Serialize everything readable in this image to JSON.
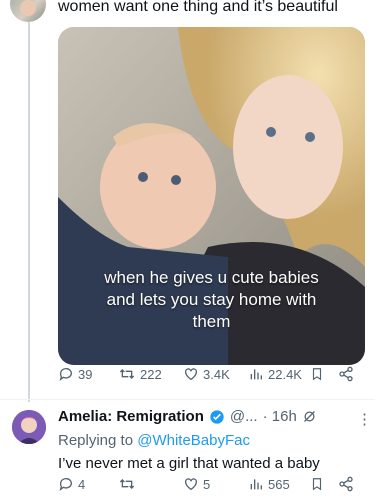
{
  "tweet": {
    "text": "women want one thing and it’s beautiful",
    "media_caption_lines": [
      "when he gives u cute babies",
      "and lets you stay home with",
      "them"
    ],
    "stats": {
      "replies": "39",
      "retweets": "222",
      "likes": "3.4K",
      "views": "22.4K"
    }
  },
  "reply": {
    "name": "Amelia: Remigration",
    "handle": "@...",
    "time": "· 16h",
    "replying_prefix": "Replying to ",
    "replying_to": "@WhiteBabyFac",
    "text": "I’ve never met a girl that wanted a baby",
    "stats": {
      "replies": "4",
      "retweets": "",
      "likes": "5",
      "views": "565"
    }
  },
  "colors": {
    "accent": "#1d9bf0",
    "muted": "#536471"
  }
}
